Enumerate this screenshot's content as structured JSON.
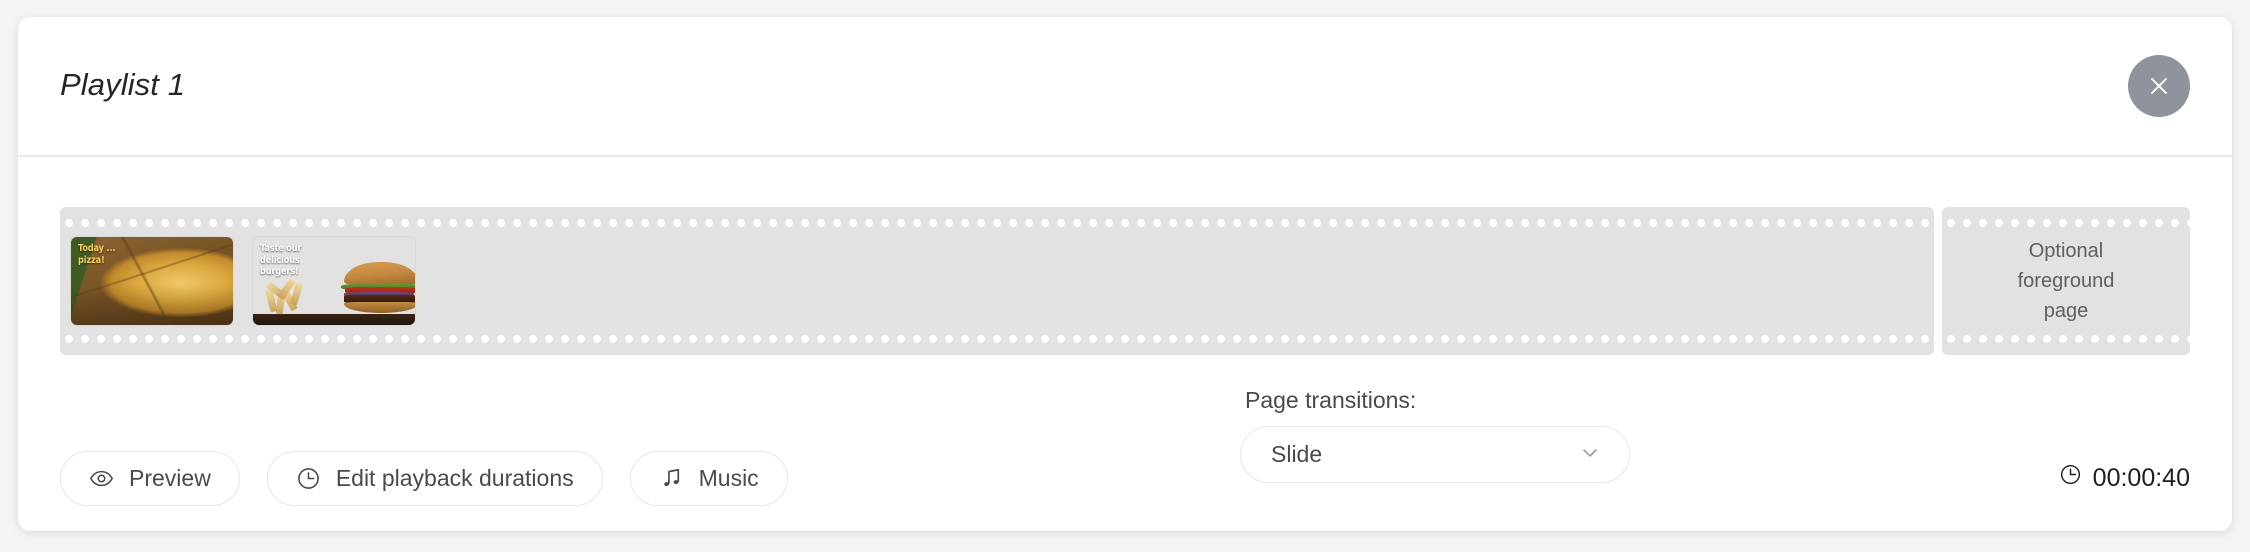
{
  "window": {
    "background_color": "#f3f4f5",
    "card_color": "#ffffff"
  },
  "header": {
    "title": "Playlist 1",
    "close_icon": "close-icon",
    "close_button_color": "#8e939c"
  },
  "playlist": {
    "items": [
      {
        "name": "pizza-page",
        "caption": "Today ...\npizza!",
        "caption_color": "#f2cf5e",
        "art": "pizza"
      },
      {
        "name": "burger-page",
        "caption": "Taste our\ndelicious\nburgers!",
        "caption_color": "#ffffff",
        "art": "burger"
      }
    ]
  },
  "foreground": {
    "label_line1": "Optional",
    "label_line2": "foreground",
    "label_line3": "page",
    "text_color": "#5f5f5f"
  },
  "toolbar": {
    "buttons": [
      {
        "label": "Preview",
        "icon": "eye-icon"
      },
      {
        "label": "Edit playback durations",
        "icon": "clock-icon"
      },
      {
        "label": "Music",
        "icon": "music-note-icon"
      }
    ]
  },
  "transitions": {
    "label": "Page transitions:",
    "selected": "Slide",
    "options": [
      "Slide"
    ],
    "chevron_icon": "chevron-down-icon"
  },
  "duration": {
    "icon": "clock-icon",
    "value": "00:00:40"
  }
}
